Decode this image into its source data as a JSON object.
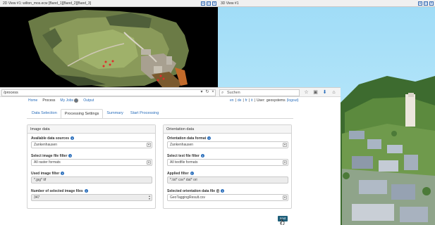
{
  "view2d": {
    "title": "2D View #1: wilton_mos.ecw [Band_1][Band_2][Band_3]",
    "window_buttons": [
      "pin-icon",
      "restore-icon",
      "close-icon"
    ]
  },
  "view3d": {
    "title": "3D View #1",
    "window_buttons": [
      "pin-icon",
      "restore-icon",
      "close-icon"
    ]
  },
  "browser": {
    "url": "/process",
    "url_buttons": [
      "dropdown-arrow-icon",
      "reload-icon",
      "close-icon"
    ],
    "search_placeholder": "Suchen",
    "toolbar_icons": [
      "star-icon",
      "clipboard-icon",
      "download-icon",
      "home-icon"
    ]
  },
  "nav": {
    "left_items": [
      "Home",
      "Process",
      "My Jobs",
      "Output"
    ],
    "jobs_badge": "0",
    "languages": [
      "en",
      "de",
      "fr",
      "it"
    ],
    "user_prefix": "User:",
    "username": "geosystems",
    "logout": "(logout)"
  },
  "tabs": [
    "Data Selection",
    "Processing Settings",
    "Summary",
    "Start Processing"
  ],
  "active_tab": 1,
  "image_panel": {
    "heading": "Image data",
    "data_sources_label": "Available data sources",
    "data_sources_value": "Zankenhausen",
    "file_filter_label": "Select image file filter",
    "file_filter_value": "All raster formats",
    "used_filter_label": "Used image filter",
    "used_filter_value": "*.jpg* tif",
    "count_label": "Number of selected image files",
    "count_value": "347"
  },
  "orientation_panel": {
    "heading": "Orientation data",
    "format_label": "Orientation data format",
    "format_value": "Zankenhausen",
    "text_filter_label": "Select text file filter",
    "text_filter_value": "All textfile formats",
    "applied_filter_label": "Applied filter",
    "applied_filter_value": "*.txt* csv* dat* ori",
    "selected_label": "Selected orientation data file",
    "selected_count": "1",
    "selected_value": "GeoTaggingResult.csv"
  },
  "next_button": "next",
  "colors": {
    "link": "#2a6ebb",
    "next_bg": "#1f5f7a",
    "sky": "#ace4fb"
  }
}
